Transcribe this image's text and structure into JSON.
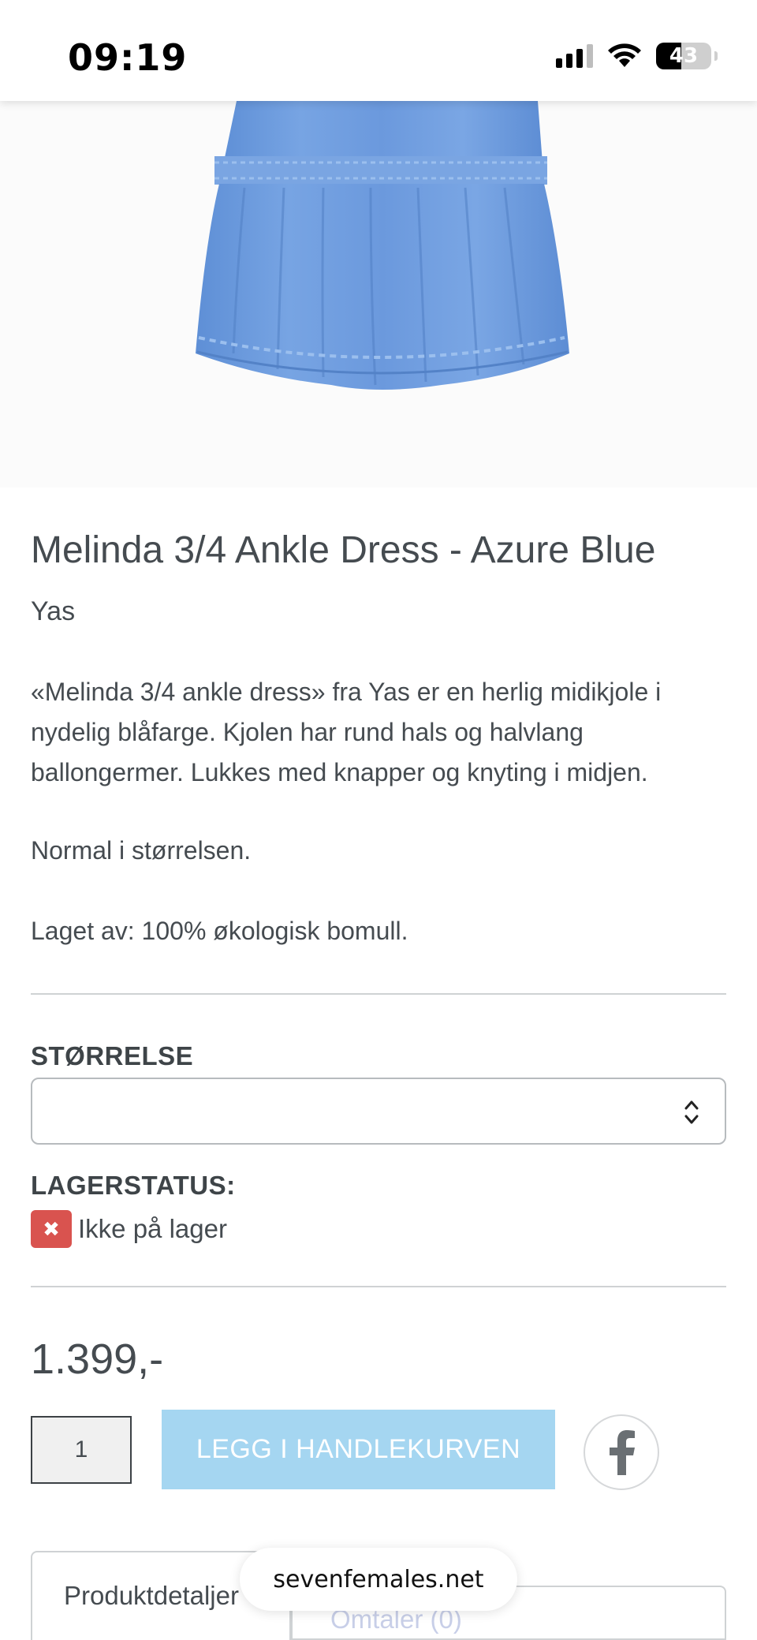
{
  "status_bar": {
    "time": "09:19",
    "battery": "43"
  },
  "product": {
    "title": "Melinda 3/4 Ankle Dress - Azure Blue",
    "brand": "Yas",
    "description": "«Melinda 3/4 ankle dress» fra Yas er en herlig midikjole i nydelig blåfarge. Kjolen har rund hals og halvlang ballongermer. Lukkes med knapper og knyting i midjen.",
    "fit": "Normal i størrelsen.",
    "material": "Laget av: 100% økologisk bomull.",
    "dress_color": "#6b99dd"
  },
  "size": {
    "label": "STØRRELSE",
    "selected": ""
  },
  "stock": {
    "label": "LAGERSTATUS:",
    "status": "Ikke på lager",
    "status_color": "#d9534f"
  },
  "price": "1.399,-",
  "cart": {
    "quantity": "1",
    "add_label": "LEGG I HANDLEKURVEN",
    "button_color": "#a5d6f1"
  },
  "share": {
    "icon": "facebook-icon"
  },
  "tabs": {
    "details": "Produktdetaljer",
    "other": "Omtaler (0)"
  },
  "browser": {
    "url": "sevenfemales.net"
  }
}
